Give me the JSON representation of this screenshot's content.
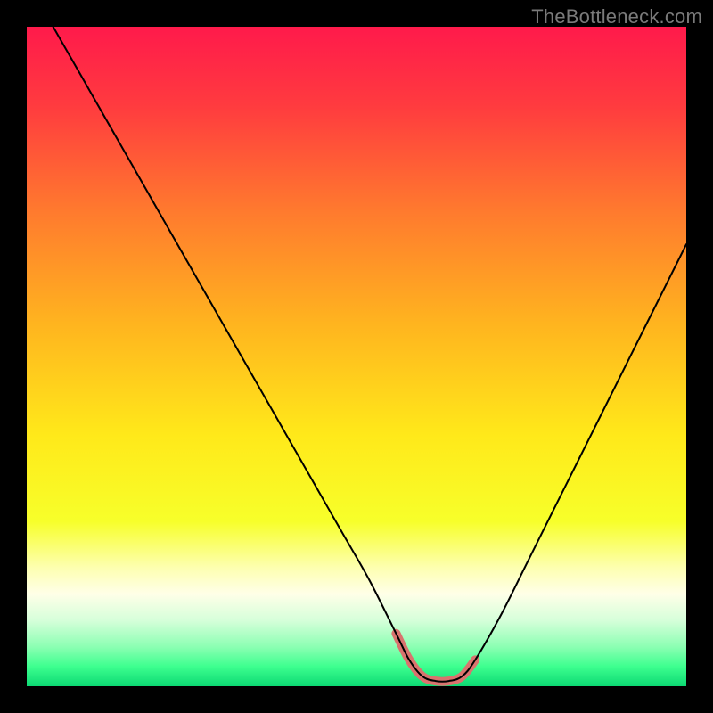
{
  "watermark": "TheBottleneck.com",
  "colors": {
    "gradient_stops": [
      {
        "offset": 0.0,
        "color": "#ff1a4b"
      },
      {
        "offset": 0.12,
        "color": "#ff3b3f"
      },
      {
        "offset": 0.28,
        "color": "#ff7a2e"
      },
      {
        "offset": 0.45,
        "color": "#ffb41f"
      },
      {
        "offset": 0.62,
        "color": "#ffe91a"
      },
      {
        "offset": 0.75,
        "color": "#f7ff2a"
      },
      {
        "offset": 0.82,
        "color": "#fdffb0"
      },
      {
        "offset": 0.86,
        "color": "#ffffe8"
      },
      {
        "offset": 0.9,
        "color": "#d6ffda"
      },
      {
        "offset": 0.94,
        "color": "#8cffb3"
      },
      {
        "offset": 0.97,
        "color": "#3dff8f"
      },
      {
        "offset": 1.0,
        "color": "#0cd973"
      }
    ],
    "curve_main": "#000000",
    "curve_highlight": "#d9736e",
    "curve_highlight_width": 10,
    "curve_main_width": 2
  },
  "chart_data": {
    "type": "line",
    "title": "",
    "xlabel": "",
    "ylabel": "",
    "xlim": [
      0,
      100
    ],
    "ylim": [
      0,
      100
    ],
    "grid": false,
    "legend": false,
    "series": [
      {
        "name": "bottleneck-curve",
        "x": [
          4,
          8,
          12,
          16,
          20,
          24,
          28,
          32,
          36,
          40,
          44,
          48,
          52,
          56,
          58,
          60,
          62,
          64,
          66,
          68,
          72,
          76,
          80,
          84,
          88,
          92,
          96,
          100
        ],
        "y": [
          100,
          93,
          86,
          79,
          72,
          65,
          58,
          51,
          44,
          37,
          30,
          23,
          16,
          8,
          4,
          1.5,
          0.8,
          0.8,
          1.5,
          4,
          11,
          19,
          27,
          35,
          43,
          51,
          59,
          67
        ]
      }
    ],
    "highlight_range_x": [
      56,
      68
    ]
  }
}
